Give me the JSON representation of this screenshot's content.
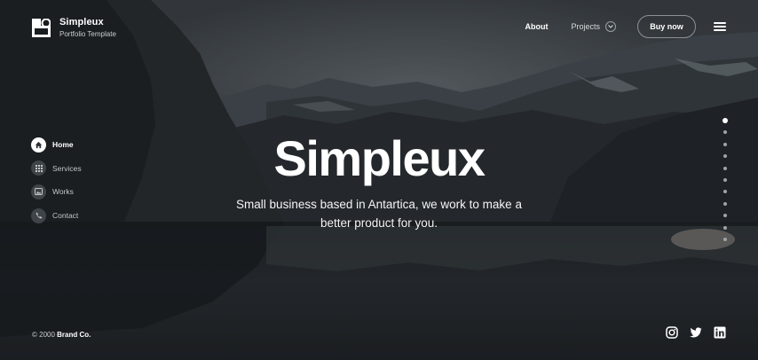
{
  "brand": {
    "name": "Simpleux",
    "tagline": "Portfolio Template",
    "logo_icon": "logo-icon"
  },
  "nav": {
    "about_label": "About",
    "projects_label": "Projects",
    "buy_label": "Buy now",
    "menu_icon": "hamburger-menu-icon"
  },
  "sidebar": {
    "items": [
      {
        "label": "Home",
        "icon": "home-icon",
        "active": true
      },
      {
        "label": "Services",
        "icon": "grid-icon",
        "active": false
      },
      {
        "label": "Works",
        "icon": "image-icon",
        "active": false
      },
      {
        "label": "Contact",
        "icon": "phone-icon",
        "active": false
      }
    ]
  },
  "hero": {
    "title": "Simpleux",
    "subtitle_line1": "Small business based in Antartica, we work to make a",
    "subtitle_line2": "better product for you."
  },
  "slider": {
    "total": 11,
    "active_index": 0
  },
  "footer": {
    "copyright_prefix": "© 2000",
    "copyright_brand": "Brand Co.",
    "social": [
      "instagram-icon",
      "twitter-icon",
      "linkedin-icon"
    ]
  },
  "colors": {
    "overlay": "#2b3034",
    "accent": "#ffffff",
    "muted_text": "#c2c6c9"
  }
}
